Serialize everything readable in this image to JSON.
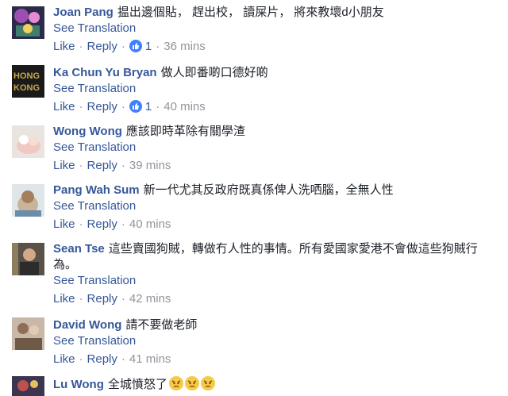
{
  "comments": [
    {
      "name": "Joan Pang",
      "text": "揾出邊個貼， 趕出校， 讀屎片， 將來教壞d小朋友",
      "see_translation": "See Translation",
      "like": "Like",
      "reply": "Reply",
      "reactions": "1",
      "time": "36 mins",
      "avatar": "avatar-joan-pang"
    },
    {
      "name": "Ka Chun Yu Bryan",
      "text": "做人即番啲口德好啲",
      "see_translation": "See Translation",
      "like": "Like",
      "reply": "Reply",
      "reactions": "1",
      "time": "40 mins",
      "avatar_text": "HONG KONG"
    },
    {
      "name": "Wong Wong",
      "text": "應該即時革除有關學渣",
      "see_translation": "See Translation",
      "like": "Like",
      "reply": "Reply",
      "time": "39 mins"
    },
    {
      "name": "Pang Wah Sum",
      "text": "新一代尤其反政府既真係俾人洗哂腦，全無人性",
      "see_translation": "See Translation",
      "like": "Like",
      "reply": "Reply",
      "time": "40 mins"
    },
    {
      "name": "Sean Tse",
      "text": "這些賣國狗賊，轉做冇人性的事情。所有愛國家愛港不會做這些狗賊行為。",
      "see_translation": "See Translation",
      "like": "Like",
      "reply": "Reply",
      "time": "42 mins"
    },
    {
      "name": "David Wong",
      "text": "請不要做老師",
      "see_translation": "See Translation",
      "like": "Like",
      "reply": "Reply",
      "time": "41 mins"
    },
    {
      "name": "Lu Wong",
      "text": "全城憤怒了",
      "emoji": "angry-face"
    }
  ],
  "colors": {
    "name": "#365899",
    "text": "#1d2129",
    "meta": "#90949c",
    "like_badge": "#4080ff"
  }
}
